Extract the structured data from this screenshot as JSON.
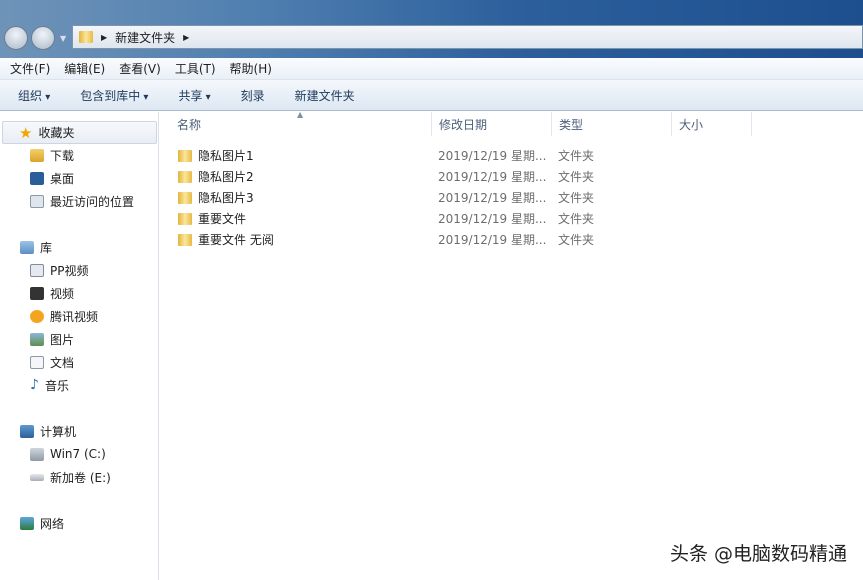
{
  "address": {
    "path": [
      "新建文件夹"
    ]
  },
  "menu": [
    "文件(F)",
    "编辑(E)",
    "查看(V)",
    "工具(T)",
    "帮助(H)"
  ],
  "toolbar": [
    {
      "label": "组织",
      "dropdown": true
    },
    {
      "label": "包含到库中",
      "dropdown": true
    },
    {
      "label": "共享",
      "dropdown": true
    },
    {
      "label": "刻录",
      "dropdown": false
    },
    {
      "label": "新建文件夹",
      "dropdown": false
    }
  ],
  "sidebar": {
    "favorites": {
      "label": "收藏夹",
      "icon": "star-icon",
      "items": [
        {
          "label": "下载",
          "icon": "download-icon"
        },
        {
          "label": "桌面",
          "icon": "desktop-icon"
        },
        {
          "label": "最近访问的位置",
          "icon": "recent-icon"
        }
      ]
    },
    "libraries": {
      "label": "库",
      "icon": "library-icon",
      "items": [
        {
          "label": "PP视频",
          "icon": "video-icon"
        },
        {
          "label": "视频",
          "icon": "film-icon"
        },
        {
          "label": "腾讯视频",
          "icon": "tencent-video-icon"
        },
        {
          "label": "图片",
          "icon": "picture-icon"
        },
        {
          "label": "文档",
          "icon": "document-icon"
        },
        {
          "label": "音乐",
          "icon": "music-icon"
        }
      ]
    },
    "computer": {
      "label": "计算机",
      "icon": "computer-icon",
      "items": [
        {
          "label": "Win7 (C:)",
          "icon": "drive-icon"
        },
        {
          "label": "新加卷 (E:)",
          "icon": "drive-icon"
        }
      ]
    },
    "network": {
      "label": "网络",
      "icon": "network-icon"
    }
  },
  "columns": [
    "名称",
    "修改日期",
    "类型",
    "大小"
  ],
  "files": [
    {
      "name": "隐私图片1",
      "date": "2019/12/19 星期...",
      "type": "文件夹"
    },
    {
      "name": "隐私图片2",
      "date": "2019/12/19 星期...",
      "type": "文件夹"
    },
    {
      "name": "隐私图片3",
      "date": "2019/12/19 星期...",
      "type": "文件夹"
    },
    {
      "name": "重要文件",
      "date": "2019/12/19 星期...",
      "type": "文件夹"
    },
    {
      "name": "重要文件 无阅",
      "date": "2019/12/19 星期...",
      "type": "文件夹"
    }
  ],
  "watermark": "头条 @电脑数码精通"
}
